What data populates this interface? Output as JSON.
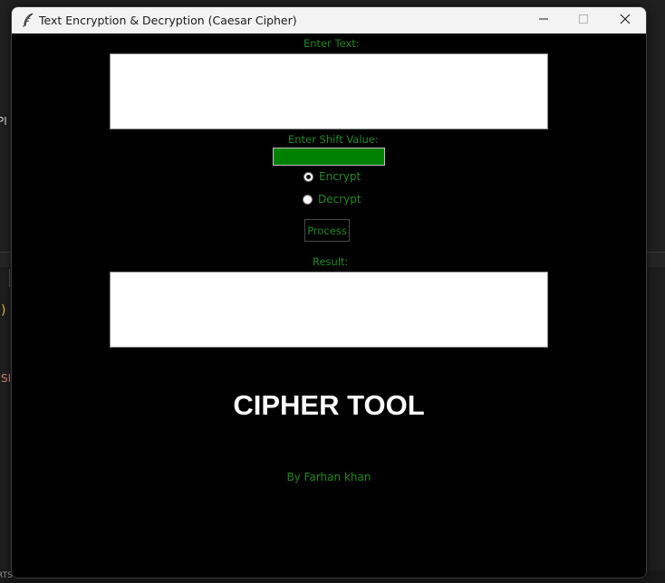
{
  "background": {
    "fragment_1": "PI",
    "fragment_2": ")",
    "fragment_3": "SI",
    "fragment_4": "RTS"
  },
  "window": {
    "title": "Text Encryption & Decryption (Caesar Cipher)",
    "icon": "feather-icon",
    "controls": [
      "minimize-icon",
      "maximize-icon",
      "close-icon"
    ]
  },
  "form": {
    "enter_text_label": "Enter Text:",
    "input_text_value": "",
    "shift_label": "Enter Shift Value:",
    "shift_value": "",
    "mode_options": [
      {
        "label": "Encrypt",
        "checked": true
      },
      {
        "label": "Decrypt",
        "checked": false
      }
    ],
    "process_button": "Process",
    "result_label": "Result:",
    "result_value": ""
  },
  "branding": {
    "title": "CIPHER TOOL",
    "byline": "By Farhan khan"
  },
  "colors": {
    "window_bg": "#000000",
    "label_green": "#1e8a1e",
    "shift_entry_bg": "#008000",
    "title_white": "#ffffff"
  }
}
